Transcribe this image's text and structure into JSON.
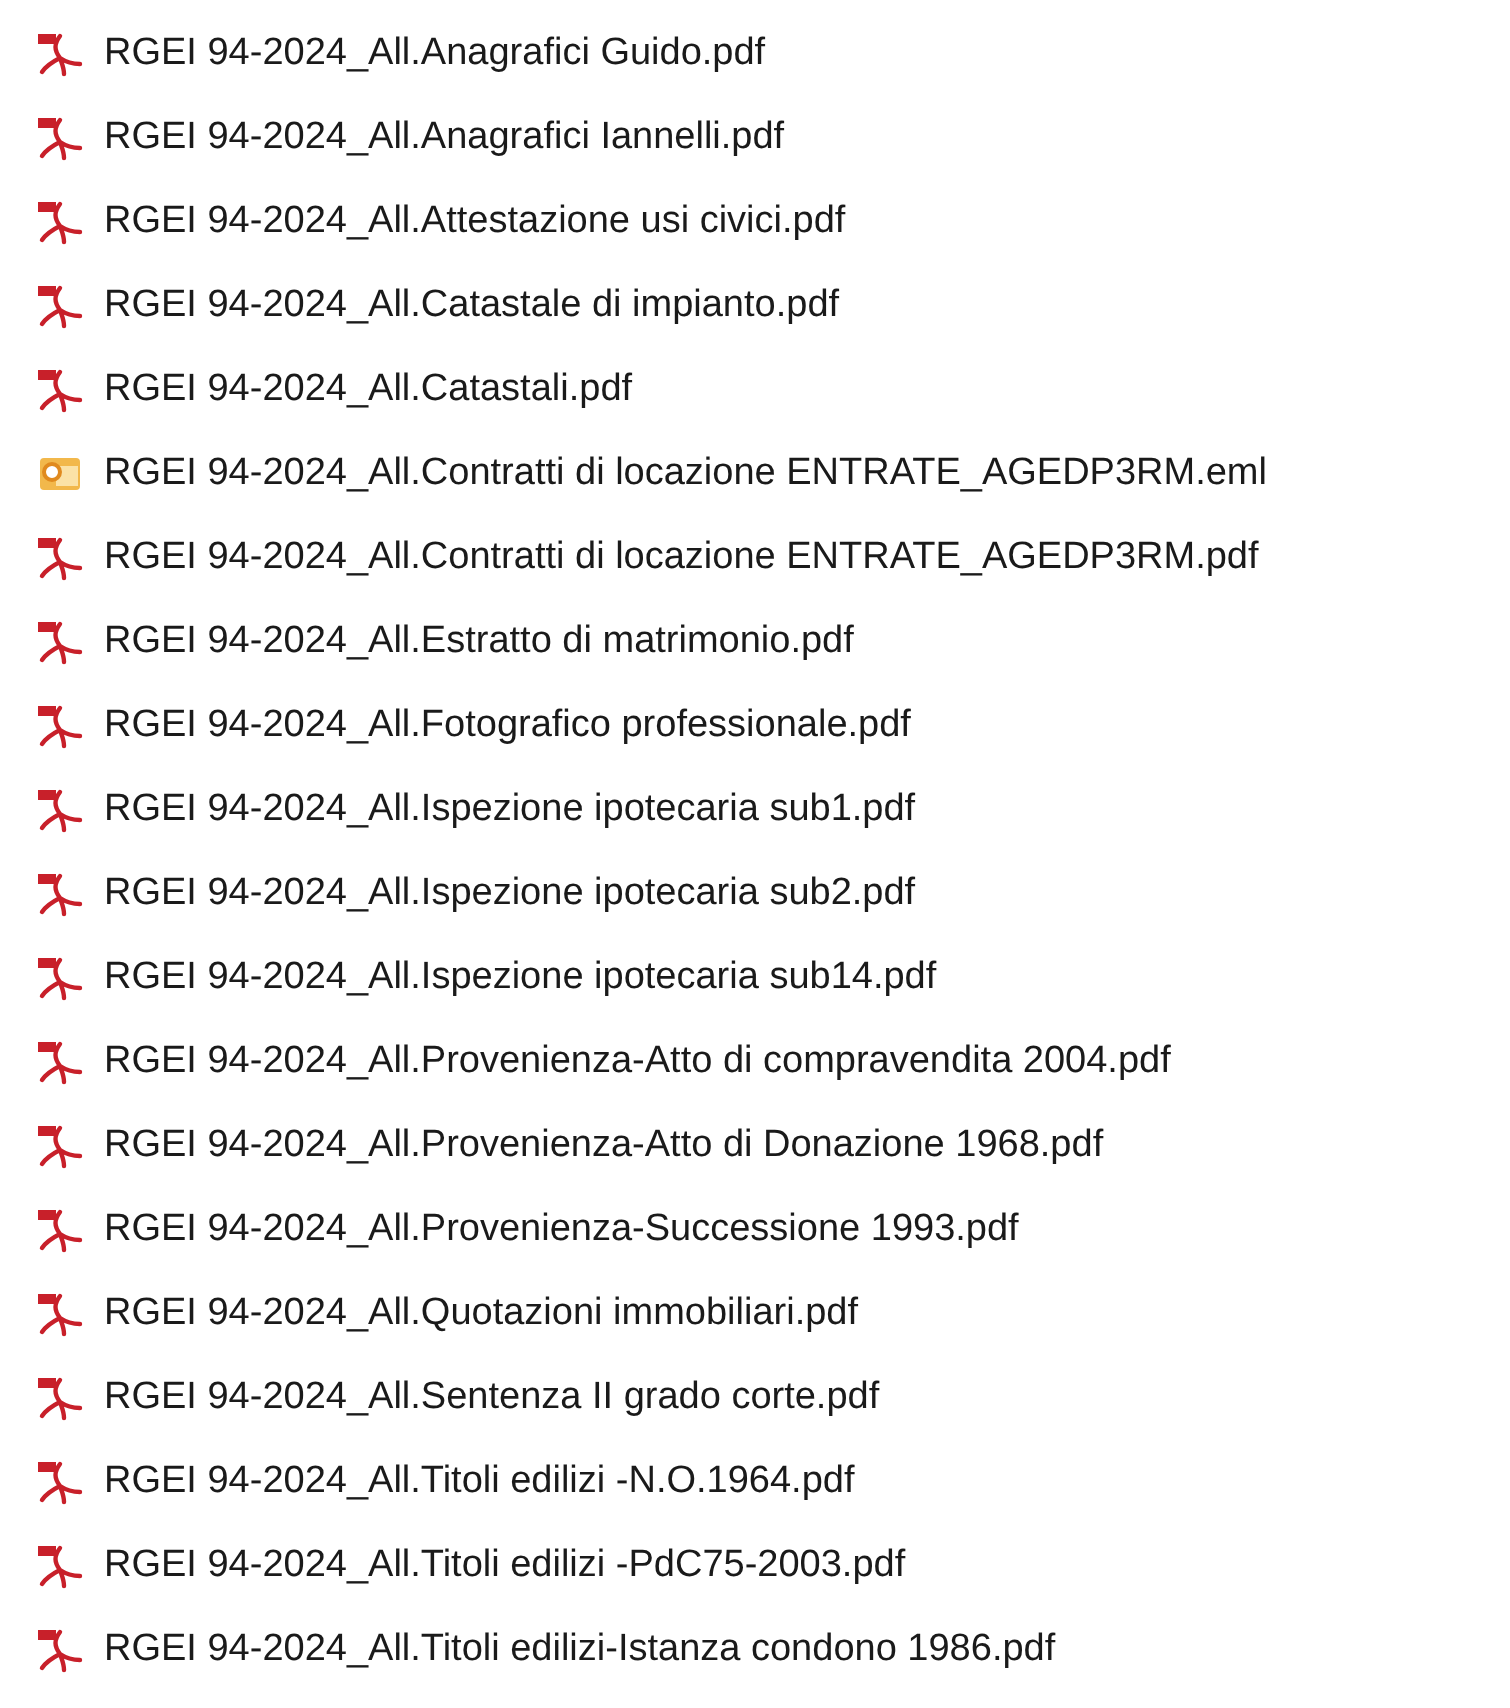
{
  "files": [
    {
      "name": "RGEI 94-2024_All.Anagrafici Guido.pdf",
      "kind": "pdf"
    },
    {
      "name": "RGEI 94-2024_All.Anagrafici Iannelli.pdf",
      "kind": "pdf"
    },
    {
      "name": "RGEI 94-2024_All.Attestazione usi civici.pdf",
      "kind": "pdf"
    },
    {
      "name": "RGEI 94-2024_All.Catastale di impianto.pdf",
      "kind": "pdf"
    },
    {
      "name": "RGEI 94-2024_All.Catastali.pdf",
      "kind": "pdf"
    },
    {
      "name": "RGEI 94-2024_All.Contratti di locazione ENTRATE_AGEDP3RM.eml",
      "kind": "eml"
    },
    {
      "name": "RGEI 94-2024_All.Contratti di locazione ENTRATE_AGEDP3RM.pdf",
      "kind": "pdf"
    },
    {
      "name": "RGEI 94-2024_All.Estratto di matrimonio.pdf",
      "kind": "pdf"
    },
    {
      "name": "RGEI 94-2024_All.Fotografico professionale.pdf",
      "kind": "pdf"
    },
    {
      "name": "RGEI 94-2024_All.Ispezione ipotecaria sub1.pdf",
      "kind": "pdf"
    },
    {
      "name": "RGEI 94-2024_All.Ispezione ipotecaria sub2.pdf",
      "kind": "pdf"
    },
    {
      "name": "RGEI 94-2024_All.Ispezione ipotecaria sub14.pdf",
      "kind": "pdf"
    },
    {
      "name": "RGEI 94-2024_All.Provenienza-Atto di compravendita 2004.pdf",
      "kind": "pdf"
    },
    {
      "name": "RGEI 94-2024_All.Provenienza-Atto di Donazione 1968.pdf",
      "kind": "pdf"
    },
    {
      "name": "RGEI 94-2024_All.Provenienza-Successione 1993.pdf",
      "kind": "pdf"
    },
    {
      "name": "RGEI 94-2024_All.Quotazioni immobiliari.pdf",
      "kind": "pdf"
    },
    {
      "name": "RGEI 94-2024_All.Sentenza II grado corte.pdf",
      "kind": "pdf"
    },
    {
      "name": "RGEI 94-2024_All.Titoli edilizi -N.O.1964.pdf",
      "kind": "pdf"
    },
    {
      "name": "RGEI 94-2024_All.Titoli edilizi -PdC75-2003.pdf",
      "kind": "pdf"
    },
    {
      "name": "RGEI 94-2024_All.Titoli edilizi-Istanza condono 1986.pdf",
      "kind": "pdf"
    }
  ]
}
